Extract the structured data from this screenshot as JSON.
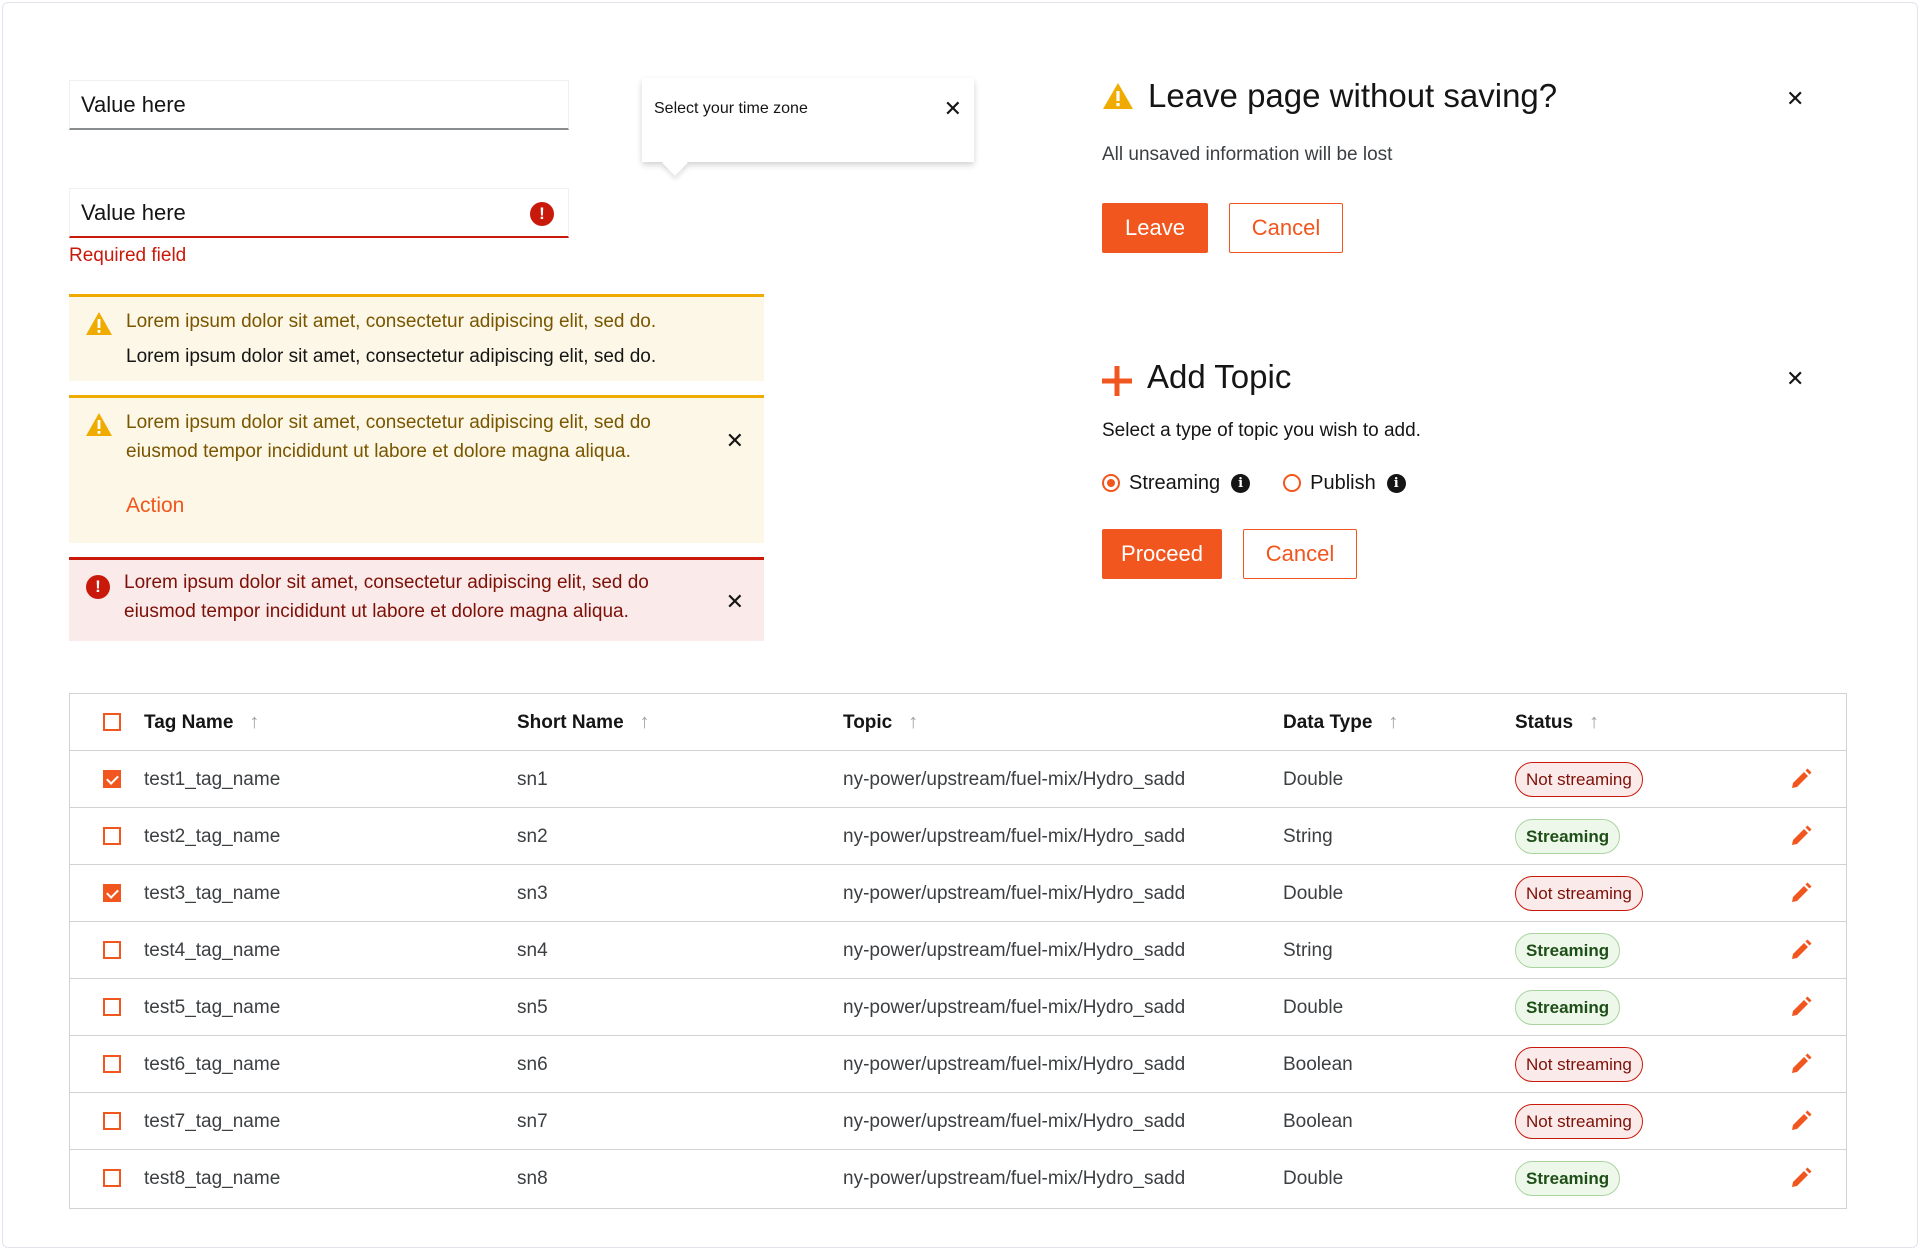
{
  "inputs": {
    "default_value": "Value here",
    "error_value": "Value here",
    "error_helper": "Required field"
  },
  "popover": {
    "text": "Select your time zone",
    "close": "✕"
  },
  "alerts": {
    "warning1": {
      "title": "Lorem ipsum dolor sit amet, consectetur adipiscing elit, sed do.",
      "body": "Lorem ipsum dolor sit amet, consectetur adipiscing elit, sed do."
    },
    "warning2": {
      "title_line1": "Lorem ipsum dolor sit amet, consectetur adipiscing elit, sed do",
      "title_line2": "eiusmod tempor incididunt ut labore et dolore magna aliqua.",
      "action": "Action",
      "close": "✕"
    },
    "danger": {
      "title_line1": "Lorem ipsum dolor sit amet, consectetur adipiscing elit, sed do",
      "title_line2": "eiusmod tempor incididunt ut labore et dolore magna aliqua.",
      "close": "✕"
    }
  },
  "leave_modal": {
    "title": "Leave page without saving?",
    "body": "All unsaved information will be lost",
    "primary": "Leave",
    "secondary": "Cancel",
    "close": "✕"
  },
  "topic_modal": {
    "title": "Add Topic",
    "body": "Select a type of topic you wish to add.",
    "options": [
      {
        "label": "Streaming",
        "selected": true
      },
      {
        "label": "Publish",
        "selected": false
      }
    ],
    "primary": "Proceed",
    "secondary": "Cancel",
    "close": "✕"
  },
  "table": {
    "headers": {
      "tag_name": "Tag Name",
      "short_name": "Short Name",
      "topic": "Topic",
      "data_type": "Data Type",
      "status": "Status"
    },
    "rows": [
      {
        "checked": true,
        "tag": "test1_tag_name",
        "short": "sn1",
        "topic": "ny-power/upstream/fuel-mix/Hydro_sadd",
        "type": "Double",
        "status": "Not streaming"
      },
      {
        "checked": false,
        "tag": "test2_tag_name",
        "short": "sn2",
        "topic": "ny-power/upstream/fuel-mix/Hydro_sadd",
        "type": "String",
        "status": "Streaming"
      },
      {
        "checked": true,
        "tag": "test3_tag_name",
        "short": "sn3",
        "topic": "ny-power/upstream/fuel-mix/Hydro_sadd",
        "type": "Double",
        "status": "Not streaming"
      },
      {
        "checked": false,
        "tag": "test4_tag_name",
        "short": "sn4",
        "topic": "ny-power/upstream/fuel-mix/Hydro_sadd",
        "type": "String",
        "status": "Streaming"
      },
      {
        "checked": false,
        "tag": "test5_tag_name",
        "short": "sn5",
        "topic": "ny-power/upstream/fuel-mix/Hydro_sadd",
        "type": "Double",
        "status": "Streaming"
      },
      {
        "checked": false,
        "tag": "test6_tag_name",
        "short": "sn6",
        "topic": "ny-power/upstream/fuel-mix/Hydro_sadd",
        "type": "Boolean",
        "status": "Not streaming"
      },
      {
        "checked": false,
        "tag": "test7_tag_name",
        "short": "sn7",
        "topic": "ny-power/upstream/fuel-mix/Hydro_sadd",
        "type": "Boolean",
        "status": "Not streaming"
      },
      {
        "checked": false,
        "tag": "test8_tag_name",
        "short": "sn8",
        "topic": "ny-power/upstream/fuel-mix/Hydro_sadd",
        "type": "Double",
        "status": "Streaming"
      }
    ]
  },
  "colors": {
    "accent": "#f0561d",
    "warning": "#f0ab00",
    "danger": "#c9190b",
    "success_bg": "#eef8ea"
  }
}
